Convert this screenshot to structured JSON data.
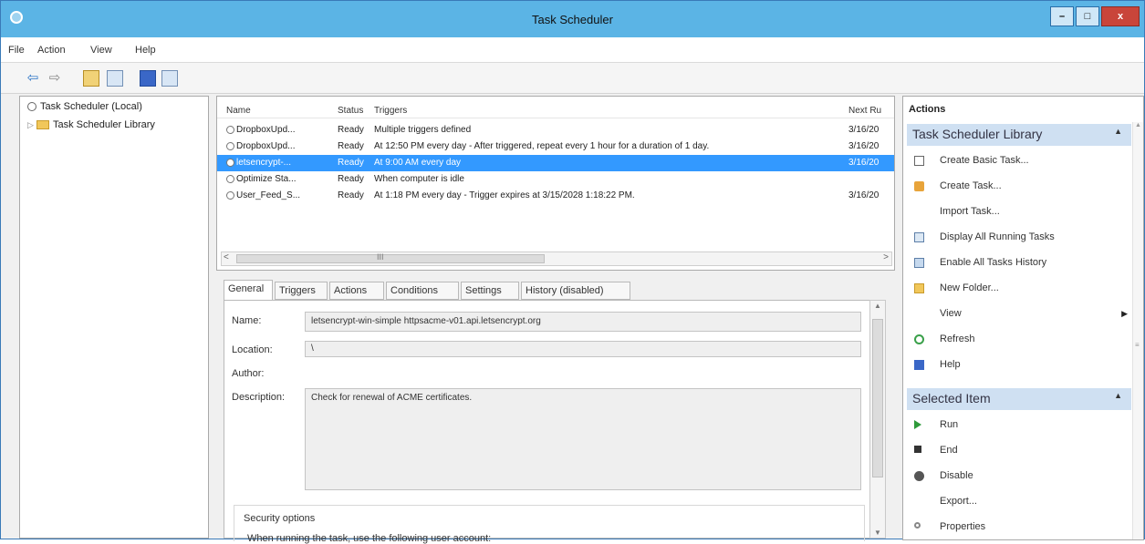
{
  "window": {
    "title": "Task Scheduler",
    "min": "–",
    "max": "□",
    "close": "x"
  },
  "menu": [
    "File",
    "Action",
    "View",
    "Help"
  ],
  "tree": {
    "root": "Task Scheduler (Local)",
    "library": "Task Scheduler Library"
  },
  "tasklist": {
    "headers": {
      "name": "Name",
      "status": "Status",
      "triggers": "Triggers",
      "next": "Next Ru"
    },
    "rows": [
      {
        "name": "DropboxUpd...",
        "status": "Ready",
        "triggers": "Multiple triggers defined",
        "next": "3/16/20"
      },
      {
        "name": "DropboxUpd...",
        "status": "Ready",
        "triggers": "At 12:50 PM every day - After triggered, repeat every 1 hour for a duration of 1 day.",
        "next": "3/16/20"
      },
      {
        "name": "letsencrypt-...",
        "status": "Ready",
        "triggers": "At 9:00 AM every day",
        "next": "3/16/20"
      },
      {
        "name": "Optimize Sta...",
        "status": "Ready",
        "triggers": "When computer is idle",
        "next": ""
      },
      {
        "name": "User_Feed_S...",
        "status": "Ready",
        "triggers": "At 1:18 PM every day - Trigger expires at 3/15/2028 1:18:22 PM.",
        "next": "3/16/20"
      }
    ],
    "grip": "III",
    "scroll_left": "<",
    "scroll_right": ">"
  },
  "tabs": [
    "General",
    "Triggers",
    "Actions",
    "Conditions",
    "Settings",
    "History (disabled)"
  ],
  "general": {
    "name_label": "Name:",
    "name_value": "letsencrypt-win-simple httpsacme-v01.api.letsencrypt.org",
    "location_label": "Location:",
    "location_value": "\\",
    "author_label": "Author:",
    "description_label": "Description:",
    "description_value": "Check for renewal of ACME certificates.",
    "security_title": "Security options",
    "security_text": "When running the task, use the following user account:"
  },
  "actions": {
    "header": "Actions",
    "library_section": "Task Scheduler Library",
    "library_items": [
      "Create Basic Task...",
      "Create Task...",
      "Import Task...",
      "Display All Running Tasks",
      "Enable All Tasks History",
      "New Folder...",
      "View",
      "Refresh",
      "Help"
    ],
    "selected_section": "Selected Item",
    "selected_items": [
      "Run",
      "End",
      "Disable",
      "Export...",
      "Properties"
    ]
  },
  "colors": {
    "titlebar": "#5bb4e5",
    "selection": "#3399ff",
    "action_section": "#cfe0f2"
  }
}
